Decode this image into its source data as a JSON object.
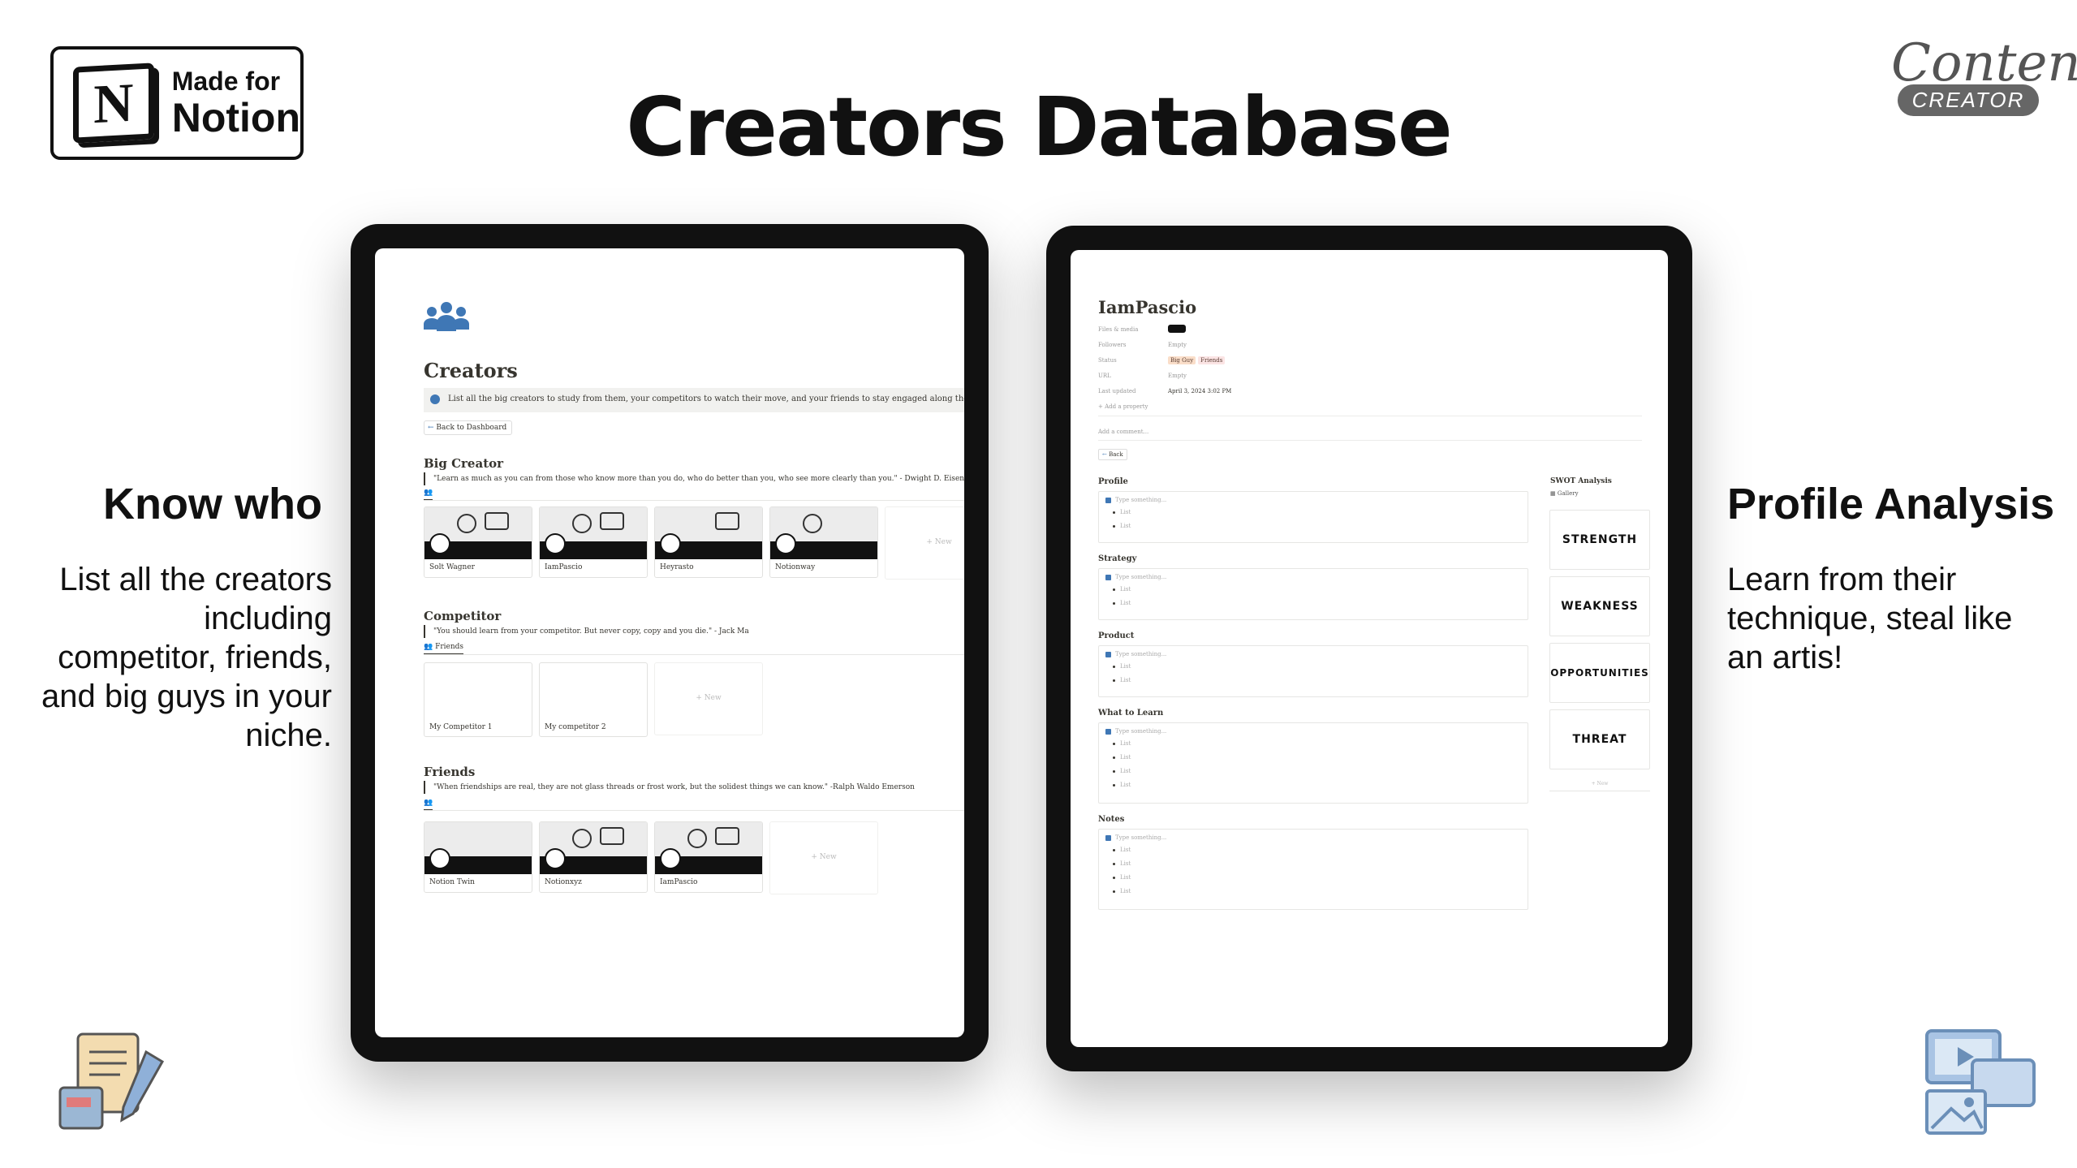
{
  "badge": {
    "sub": "Made for",
    "main": "Notion",
    "logo_letter": "N"
  },
  "title": "Creators Database",
  "brand": {
    "script": "Content",
    "pill": "CREATOR"
  },
  "left_panel": {
    "heading": "Know who",
    "text": "List all the creators including competitor, friends, and big guys in your niche."
  },
  "right_panel": {
    "heading": "Profile Analysis",
    "text": "Learn from their technique, steal like an artis!"
  },
  "creators_page": {
    "title": "Creators",
    "callout": "List all the big creators to study from them, your competitors to watch their move, and your friends to stay engaged along the journey",
    "back_button": "Back to Dashboard",
    "new_label": "+ New",
    "sections": [
      {
        "heading": "Big Creator",
        "quote": "\"Learn as much as you can from those who know more than you do, who do better than you, who see more clearly than you.\" - Dwight D. Eisenhower",
        "view": "",
        "cards": [
          "Solt Wagner",
          "IamPascio",
          "Heyrasto",
          "Notionway"
        ]
      },
      {
        "heading": "Competitor",
        "quote": "\"You should learn from your competitor. But never copy, copy and you die.\" - Jack Ma",
        "view": "Friends",
        "cards": [
          "My Competitor 1",
          "My competitor 2"
        ]
      },
      {
        "heading": "Friends",
        "quote": "\"When friendships are real, they are not glass threads or frost work, but the solidest things we can know.\" -Ralph Waldo Emerson",
        "view": "",
        "cards": [
          "Notion Twin",
          "Notionxyz",
          "IamPascio"
        ]
      }
    ]
  },
  "profile_page": {
    "title": "IamPascio",
    "properties": [
      {
        "label": "Files & media",
        "value": ""
      },
      {
        "label": "Followers",
        "value": "Empty"
      },
      {
        "label": "Status",
        "tags": [
          "Big Guy",
          "Friends"
        ]
      },
      {
        "label": "URL",
        "value": "Empty"
      },
      {
        "label": "Last updated",
        "value": "April 3, 2024 3:02 PM"
      },
      {
        "label": "+ Add a property",
        "value": ""
      }
    ],
    "comment": "Add a comment...",
    "back": "Back",
    "placeholder": "Type something...",
    "list_item": "List",
    "sections": [
      {
        "heading": "Profile",
        "items": 2
      },
      {
        "heading": "Strategy",
        "items": 2
      },
      {
        "heading": "Product",
        "items": 2
      },
      {
        "heading": "What to Learn",
        "items": 4
      },
      {
        "heading": "Notes",
        "items": 4
      }
    ],
    "swot": {
      "heading": "SWOT Analysis",
      "view": "Gallery",
      "items": [
        "STRENGTH",
        "WEAKNESS",
        "OPPORTUNITIES",
        "THREAT"
      ],
      "new": "+ New"
    }
  },
  "colors": {
    "accent_blue": "#3f77b5",
    "tag_big_guy": "#fadec9",
    "tag_friends": "#fbe4e4"
  }
}
